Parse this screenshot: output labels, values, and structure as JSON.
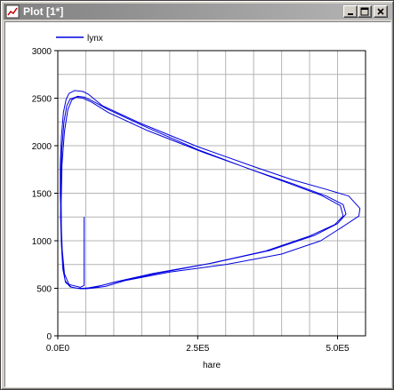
{
  "window": {
    "title": "Plot [1*]",
    "icon": "plot-app-icon",
    "buttons": [
      {
        "name": "minimize-button",
        "icon": "minimize-icon"
      },
      {
        "name": "maximize-button",
        "icon": "maximize-icon"
      },
      {
        "name": "close-button",
        "icon": "close-icon"
      }
    ]
  },
  "colors": {
    "series": "#0000e0",
    "grid": "#b4b4b4",
    "titlebar_start": "#808080",
    "titlebar_end": "#b6b6b6"
  },
  "chart_data": {
    "type": "line",
    "title": "",
    "xlabel": "hare",
    "ylabel": "",
    "xlim": [
      0,
      550000
    ],
    "ylim": [
      0,
      3000
    ],
    "x_ticks": [
      0,
      250000,
      500000
    ],
    "x_tick_labels": [
      "0.0E0",
      "2.5E5",
      "5.0E5"
    ],
    "y_ticks": [
      0,
      500,
      1000,
      1500,
      2000,
      2500,
      3000
    ],
    "y_tick_labels": [
      "0",
      "500",
      "1000",
      "1500",
      "2000",
      "2500",
      "3000"
    ],
    "grid": true,
    "legend_position": "top-left",
    "series": [
      {
        "name": "lynx",
        "color": "#0000e0",
        "x": [
          47000,
          47000,
          40000,
          20000,
          12000,
          8000,
          5500,
          4500,
          4500,
          6500,
          10000,
          15000,
          20000,
          30000,
          45000,
          55000,
          80000,
          150000,
          250000,
          350000,
          420000,
          480000,
          520000,
          540000,
          538000,
          510000,
          470000,
          400000,
          300000,
          200000,
          120000,
          85000,
          60000,
          50000,
          40000,
          25000,
          14000,
          9000,
          6500,
          5000,
          5200,
          7000,
          11000,
          16000,
          22000,
          32000,
          45000,
          60000,
          90000,
          160000,
          260000,
          350000,
          420000,
          480000,
          510000,
          515000,
          500000,
          460000,
          380000,
          280000,
          180000,
          110000,
          75000,
          55000,
          45000,
          35000,
          22000,
          13000,
          8500,
          6500,
          6000,
          7500,
          12000,
          18000,
          25000,
          35000,
          48000,
          62000,
          90000,
          160000,
          250000,
          340000,
          410000,
          470000,
          505000,
          510000,
          495000,
          450000,
          370000,
          270000,
          170000,
          105000,
          72000,
          52000
        ],
        "y": [
          1250,
          530,
          510,
          540,
          650,
          900,
          1250,
          1500,
          1800,
          2100,
          2350,
          2490,
          2550,
          2580,
          2570,
          2540,
          2420,
          2230,
          1990,
          1780,
          1640,
          1540,
          1470,
          1340,
          1260,
          1150,
          1000,
          860,
          750,
          670,
          580,
          520,
          500,
          495,
          495,
          510,
          560,
          700,
          950,
          1250,
          1600,
          1950,
          2250,
          2420,
          2490,
          2510,
          2500,
          2460,
          2350,
          2160,
          1930,
          1740,
          1600,
          1470,
          1380,
          1280,
          1180,
          1060,
          900,
          770,
          660,
          575,
          525,
          505,
          500,
          500,
          515,
          580,
          760,
          1050,
          1400,
          1800,
          2150,
          2380,
          2480,
          2520,
          2510,
          2470,
          2380,
          2190,
          1960,
          1760,
          1610,
          1480,
          1370,
          1260,
          1170,
          1050,
          890,
          760,
          655,
          570,
          520,
          500
        ]
      }
    ]
  }
}
